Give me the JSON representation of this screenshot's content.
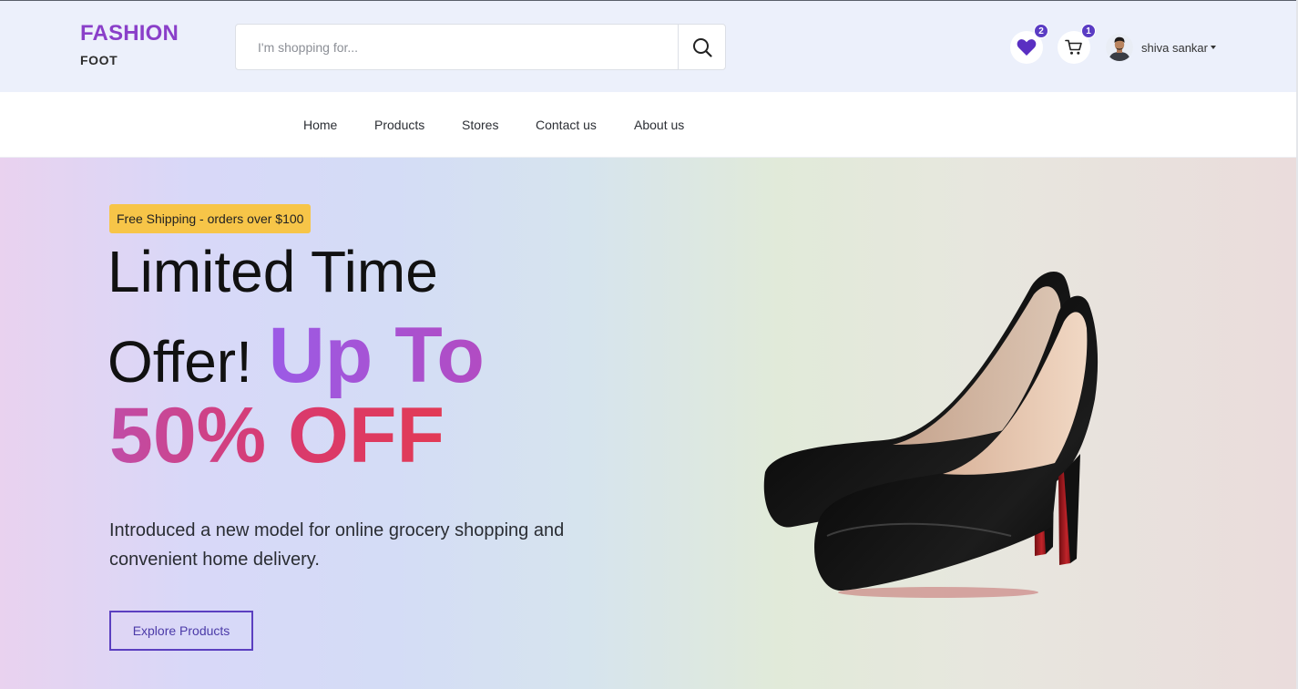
{
  "brand": {
    "title": "FASHION",
    "subtitle": "FOOT"
  },
  "search": {
    "placeholder": "I'm shopping for...",
    "value": "",
    "icon": "search-icon"
  },
  "header": {
    "wishlist": {
      "icon": "heart-icon",
      "count": "2"
    },
    "cart": {
      "icon": "cart-icon",
      "count": "1"
    },
    "user": {
      "name": "shiva sankar",
      "icon": "avatar"
    }
  },
  "nav": {
    "items": [
      {
        "label": "Home"
      },
      {
        "label": "Products"
      },
      {
        "label": "Stores"
      },
      {
        "label": "Contact us"
      },
      {
        "label": "About us"
      }
    ]
  },
  "hero": {
    "badge": "Free Shipping - orders over $100",
    "headline_line1": "Limited Time",
    "headline_line2_plain": "Offer!",
    "headline_line2_accent": "Up To",
    "headline_line3": "50% OFF",
    "description": "Introduced a new model for online grocery shopping and convenient home delivery.",
    "cta_label": "Explore Products",
    "image": "high-heel-shoe-image"
  },
  "colors": {
    "brand": "#8a3fc9",
    "accent": "#5a3cc4",
    "badge": "#f7c548",
    "gradient_start": "#9b5be6",
    "gradient_end": "#e23a55"
  }
}
